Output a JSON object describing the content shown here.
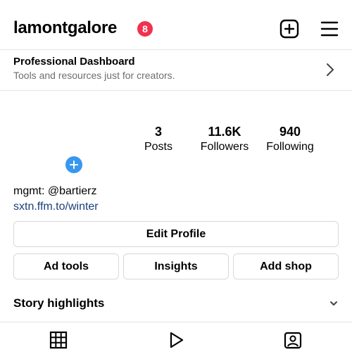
{
  "header": {
    "username": "lamontgalore",
    "notification_count": "8",
    "icons": [
      "plus-square-icon",
      "menu-icon"
    ]
  },
  "dashboard": {
    "title": "Professional Dashboard",
    "subtitle": "Tools and resources just for creators."
  },
  "stats": [
    {
      "value": "3",
      "label": "Posts"
    },
    {
      "value": "11.6K",
      "label": "Followers"
    },
    {
      "value": "940",
      "label": "Following"
    }
  ],
  "bio": {
    "text": "mgmt: @bartierz",
    "link": "sxtn.ffm.to/winter"
  },
  "buttons": {
    "edit_profile": "Edit Profile",
    "ad_tools": "Ad tools",
    "insights": "Insights",
    "add_shop": "Add shop"
  },
  "highlights": {
    "title": "Story highlights"
  },
  "tabs": [
    "grid-icon",
    "reels-play-icon",
    "tagged-person-icon"
  ],
  "colors": {
    "accent": "#3897f0",
    "badge": "#f0324f",
    "link": "#1a3f7a"
  }
}
